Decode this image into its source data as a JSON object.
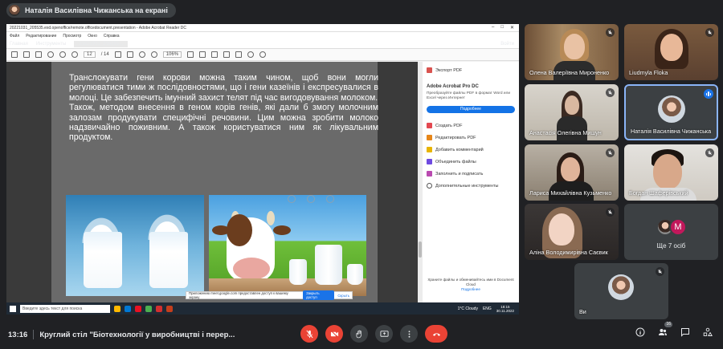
{
  "presenter": {
    "label": "Наталія Василівна Чижанська на екрані"
  },
  "acrobat": {
    "window_title": "20221031_205535.exd.openoffice/remote.officedocument.presentation - Adobe Acrobat Reader DC",
    "menu": [
      "Файл",
      "Редактирование",
      "Просмотр",
      "Окно",
      "Справка"
    ],
    "tabs": [
      "Главная",
      "Инструменты"
    ],
    "doc_tab": "20221031_205355...",
    "sign_in": "Войти",
    "page_current": "12",
    "page_total": "/ 14",
    "zoom": "106%"
  },
  "slide": {
    "paragraph1": "Транслокувати гени корови можна таким чином, щоб вони могли регулюватися тими ж послідовностями, що і гени казеїнів і експресувалися в молоці. Це забезпечить імунний захист телят під час вигодовування молоком.",
    "paragraph2": "Також, методом внесення в геном корів генів, які дали б змогу молочним залозам продукувати специфічні речовини. Цим можна зробити молоко надзвичайно поживним. А також користуватися ним як лікувальним продуктом."
  },
  "side_pane": {
    "export_label": "Экспорт PDF",
    "product": "Adobe Acrobat Pro DC",
    "description": "Преобразуйте файлы PDF в формат Word или Excel через Интернет",
    "details_btn": "Подробнее",
    "tools": [
      "Создать PDF",
      "Редактировать PDF",
      "Добавить комментарий",
      "Объединить файлы",
      "Заполнить и подписать",
      "Дополнительные инструменты"
    ],
    "footer_text": "Храните файлы и обменивайтесь ими в Document Cloud",
    "footer_link": "Подробнее"
  },
  "share_banner": {
    "text": "Приложению meet.google.com предоставлен доступ к вашему экрану",
    "stop": "Закрыть доступ",
    "hide": "Скрыть"
  },
  "taskbar": {
    "search": "Введите здесь текст для поиска",
    "weather": "1°C Cloudy",
    "lang": "ENG",
    "time": "18:15",
    "date": "30.11.2022"
  },
  "participants": [
    {
      "name": "Олена Валеріївна Мироненко"
    },
    {
      "name": "Liudmyla Floka"
    },
    {
      "name": "Анастасія Олегівна Мишун"
    },
    {
      "name": "Наталія Василівна Чижанська"
    },
    {
      "name": "Лариса Михайлівна Кузьменко"
    },
    {
      "name": "Богдан Шаферівський"
    },
    {
      "name": "Аліна Володимирівна Саєвик"
    }
  ],
  "more_tile": {
    "initial": "M",
    "label": "Ще 7 осіб"
  },
  "self_tile": {
    "name": "Ви"
  },
  "bottom": {
    "time": "13:16",
    "meeting_title": "Круглий стіл \"Біотехнології у виробництві і перер...",
    "people_count": "16"
  },
  "colors": {
    "end_call": "#ea4335",
    "active": "#8ab4f8",
    "adobe_blue": "#1473e6"
  }
}
